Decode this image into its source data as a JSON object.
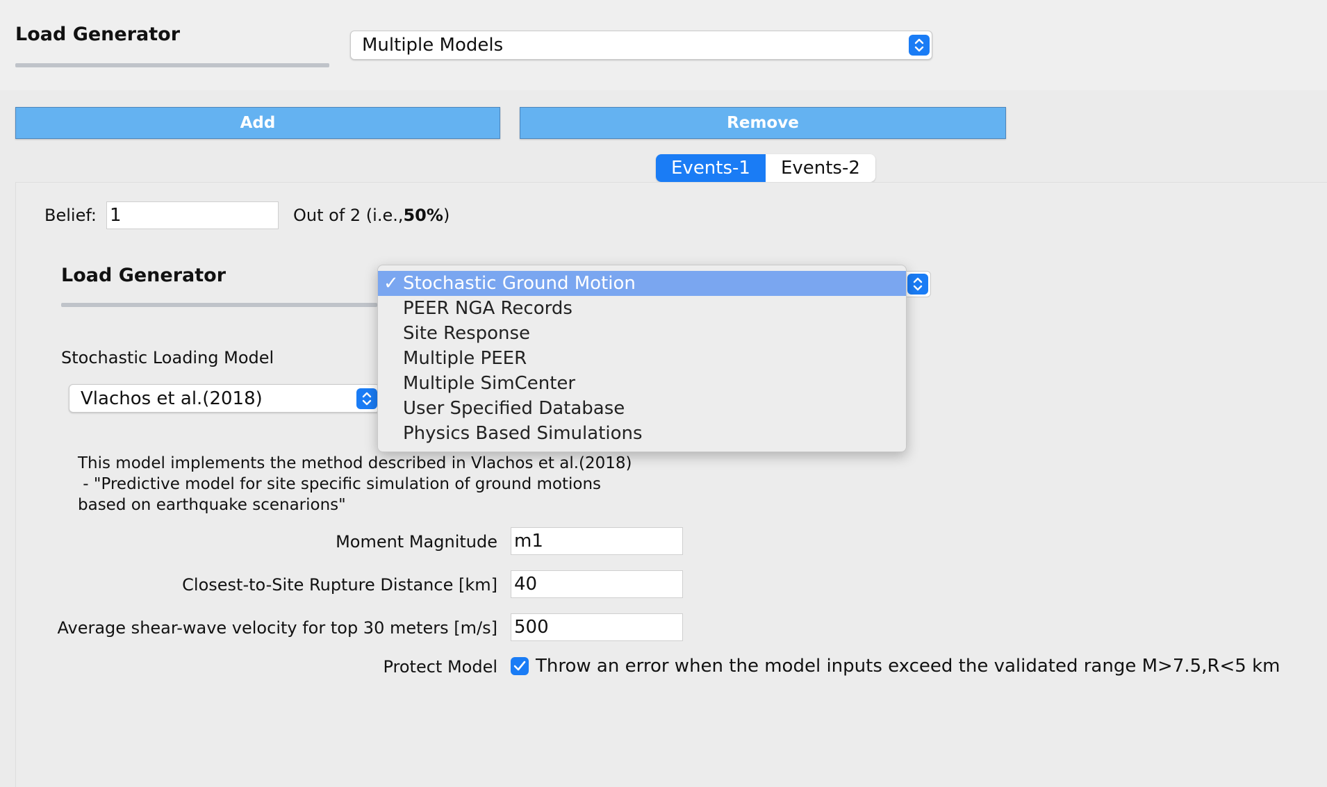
{
  "header": {
    "title": "Load Generator",
    "select_value": "Multiple Models"
  },
  "toolbar": {
    "add_label": "Add",
    "remove_label": "Remove"
  },
  "tabs": [
    {
      "label": "Events-1",
      "active": true
    },
    {
      "label": "Events-2",
      "active": false
    }
  ],
  "belief": {
    "label": "Belief:",
    "value": "1",
    "out_of_text": "Out of 2 (i.e.,",
    "percent": "50%",
    "close_paren": ")"
  },
  "inner": {
    "title": "Load Generator",
    "dropdown_items": [
      {
        "label": "Stochastic Ground Motion",
        "selected": true
      },
      {
        "label": "PEER NGA Records",
        "selected": false
      },
      {
        "label": "Site Response",
        "selected": false
      },
      {
        "label": "Multiple PEER",
        "selected": false
      },
      {
        "label": "Multiple SimCenter",
        "selected": false
      },
      {
        "label": "User Specified Database",
        "selected": false
      },
      {
        "label": "Physics Based Simulations",
        "selected": false
      }
    ],
    "check_mark": "✓",
    "stochastic_label": "Stochastic Loading Model",
    "stochastic_value": "Vlachos et al.(2018)",
    "description": "This model implements the method described in Vlachos et al.(2018)\n - \"Predictive model for site specific simulation of ground motions\nbased on earthquake scenarions\"",
    "fields": {
      "moment_label": "Moment Magnitude",
      "moment_value": "m1",
      "distance_label": "Closest-to-Site Rupture Distance [km]",
      "distance_value": "40",
      "velocity_label": "Average shear-wave velocity for top 30 meters [m/s]",
      "velocity_value": "500"
    },
    "protect_label": "Protect Model",
    "protect_checked": true,
    "protect_text": "Throw an error when the model inputs exceed the validated range M>7.5,R<5 km"
  },
  "colors": {
    "accent": "#1a7cf5",
    "button": "#64b2f1",
    "highlight": "#7aa6f0"
  }
}
